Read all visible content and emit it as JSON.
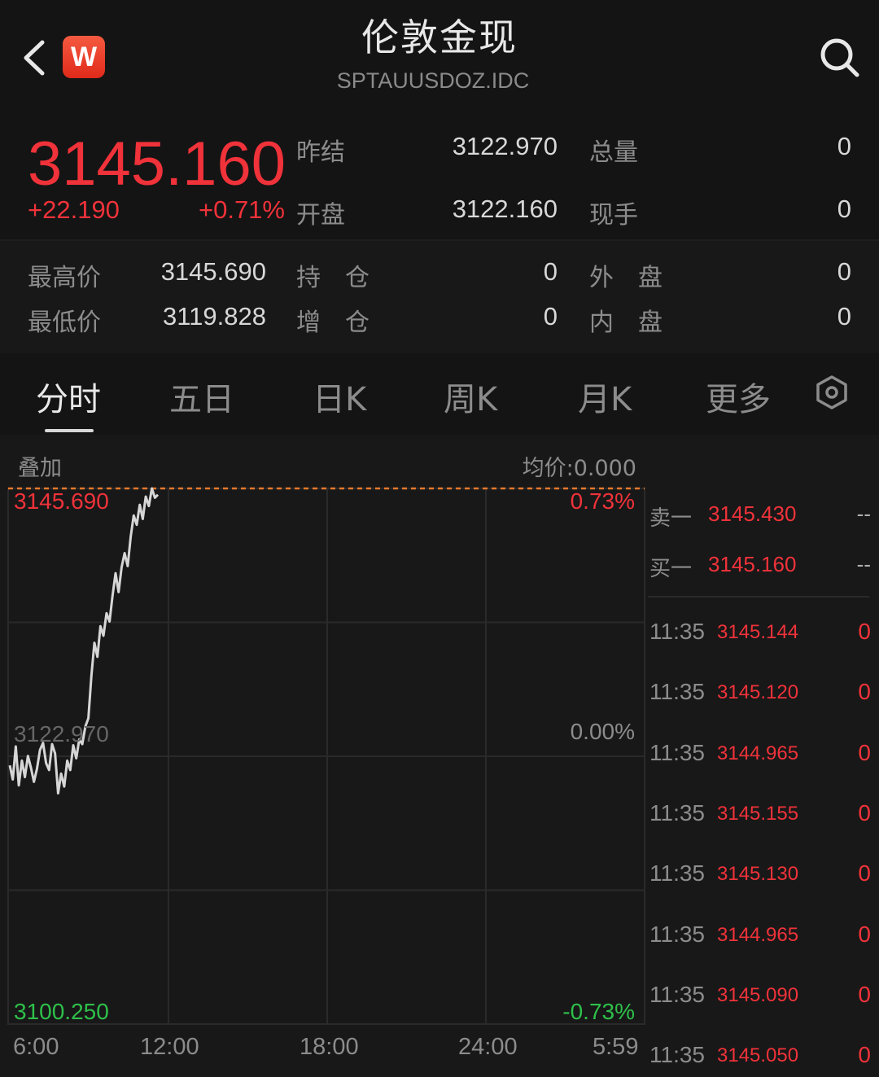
{
  "header": {
    "title": "伦敦金现",
    "subtitle": "SPTAUUSDOZ.IDC",
    "logo_letter": "W"
  },
  "quote": {
    "price": "3145.160",
    "change": "+22.190",
    "change_pct": "+0.71%",
    "stats": [
      {
        "label": "昨结",
        "value": "3122.970"
      },
      {
        "label": "总量",
        "value": "0"
      },
      {
        "label": "开盘",
        "value": "3122.160"
      },
      {
        "label": "现手",
        "value": "0"
      },
      {
        "label": "最高价",
        "value": "3145.690"
      },
      {
        "label": "持　仓",
        "value": "0"
      },
      {
        "label": "外　盘",
        "value": "0"
      },
      {
        "label": "最低价",
        "value": "3119.828"
      },
      {
        "label": "增　仓",
        "value": "0"
      },
      {
        "label": "内　盘",
        "value": "0"
      }
    ]
  },
  "tabs": [
    "分时",
    "五日",
    "日K",
    "周K",
    "月K",
    "更多"
  ],
  "active_tab": "分时",
  "chart_header": {
    "overlay": "叠加",
    "avg_price": "均价:0.000"
  },
  "chart_data": {
    "type": "line",
    "x_ticks": [
      "6:00",
      "12:00",
      "18:00",
      "24:00",
      "5:59"
    ],
    "y_left_labels": {
      "top": "3145.690",
      "mid": "3122.970",
      "bottom": "3100.250"
    },
    "y_right_labels": {
      "top": "0.73%",
      "mid": "0.00%",
      "bottom": "-0.73%"
    },
    "ylim": [
      3100.25,
      3145.69
    ],
    "reference": 3122.97,
    "high_line": 3145.69,
    "series": [
      {
        "values": [
          3122.2,
          3121.0,
          3123.8,
          3120.5,
          3122.6,
          3121.2,
          3123.0,
          3122.0,
          3120.8,
          3121.9,
          3123.5,
          3124.1,
          3122.4,
          3121.8,
          3124.0,
          3123.2,
          3119.83,
          3121.5,
          3120.4,
          3122.6,
          3121.8,
          3123.9,
          3122.8,
          3124.4,
          3124.0,
          3125.5,
          3126.2,
          3129.8,
          3132.6,
          3131.4,
          3134.0,
          3133.2,
          3135.1,
          3134.4,
          3136.6,
          3138.5,
          3136.9,
          3139.0,
          3140.2,
          3139.1,
          3141.6,
          3143.4,
          3142.6,
          3144.3,
          3143.1,
          3145.0,
          3144.2,
          3145.69,
          3144.9,
          3145.16
        ]
      }
    ],
    "colors": {
      "line": "#d6d6d6",
      "high_line": "#e8782a",
      "up": "#f0323a",
      "down": "#2ec04a",
      "grid": "#2a2a2a"
    }
  },
  "order_book": [
    {
      "label": "卖一",
      "price": "3145.430",
      "vol": "--"
    },
    {
      "label": "买一",
      "price": "3145.160",
      "vol": "--"
    }
  ],
  "ticks": [
    {
      "time": "11:35",
      "price": "3145.144",
      "vol": "0"
    },
    {
      "time": "11:35",
      "price": "3145.120",
      "vol": "0"
    },
    {
      "time": "11:35",
      "price": "3144.965",
      "vol": "0"
    },
    {
      "time": "11:35",
      "price": "3145.155",
      "vol": "0"
    },
    {
      "time": "11:35",
      "price": "3145.130",
      "vol": "0"
    },
    {
      "time": "11:35",
      "price": "3144.965",
      "vol": "0"
    },
    {
      "time": "11:35",
      "price": "3145.090",
      "vol": "0"
    },
    {
      "time": "11:35",
      "price": "3145.050",
      "vol": "0"
    }
  ],
  "icons": {
    "back": "chevron-left-icon",
    "search": "search-icon",
    "settings": "hexagon-settings-icon"
  }
}
